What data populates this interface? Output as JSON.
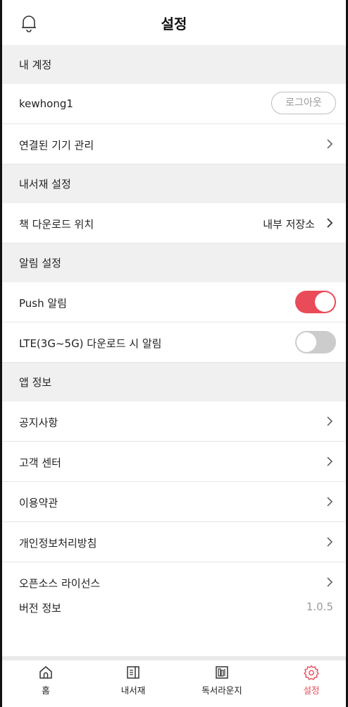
{
  "header": {
    "title": "설정",
    "bell_icon": "bell-icon"
  },
  "sections": {
    "account": "내 계정",
    "library": "내서재 설정",
    "notification": "알림 설정",
    "app_info": "앱 정보"
  },
  "account": {
    "username": "kewhong1",
    "logout_label": "로그아웃",
    "devices_label": "연결된 기기 관리"
  },
  "library": {
    "download_location_label": "책 다운로드 위치",
    "download_location_value": "내부 저장소"
  },
  "notification": {
    "push_label": "Push 알림",
    "push_on": true,
    "lte_label": "LTE(3G~5G) 다운로드 시 알림",
    "lte_on": false
  },
  "app_info": {
    "notice_label": "공지사항",
    "support_label": "고객 센터",
    "terms_label": "이용약관",
    "privacy_label": "개인정보처리방침",
    "opensource_label": "오픈소스 라이선스",
    "version_label": "버전 정보",
    "version_value": "1.0.5"
  },
  "tabbar": {
    "home": "홈",
    "library": "내서재",
    "lounge": "독서라운지",
    "settings": "설정",
    "active": "settings"
  },
  "colors": {
    "accent": "#e94b58",
    "toggle_off": "#cccccc",
    "section_bg": "#f0f0f0"
  }
}
